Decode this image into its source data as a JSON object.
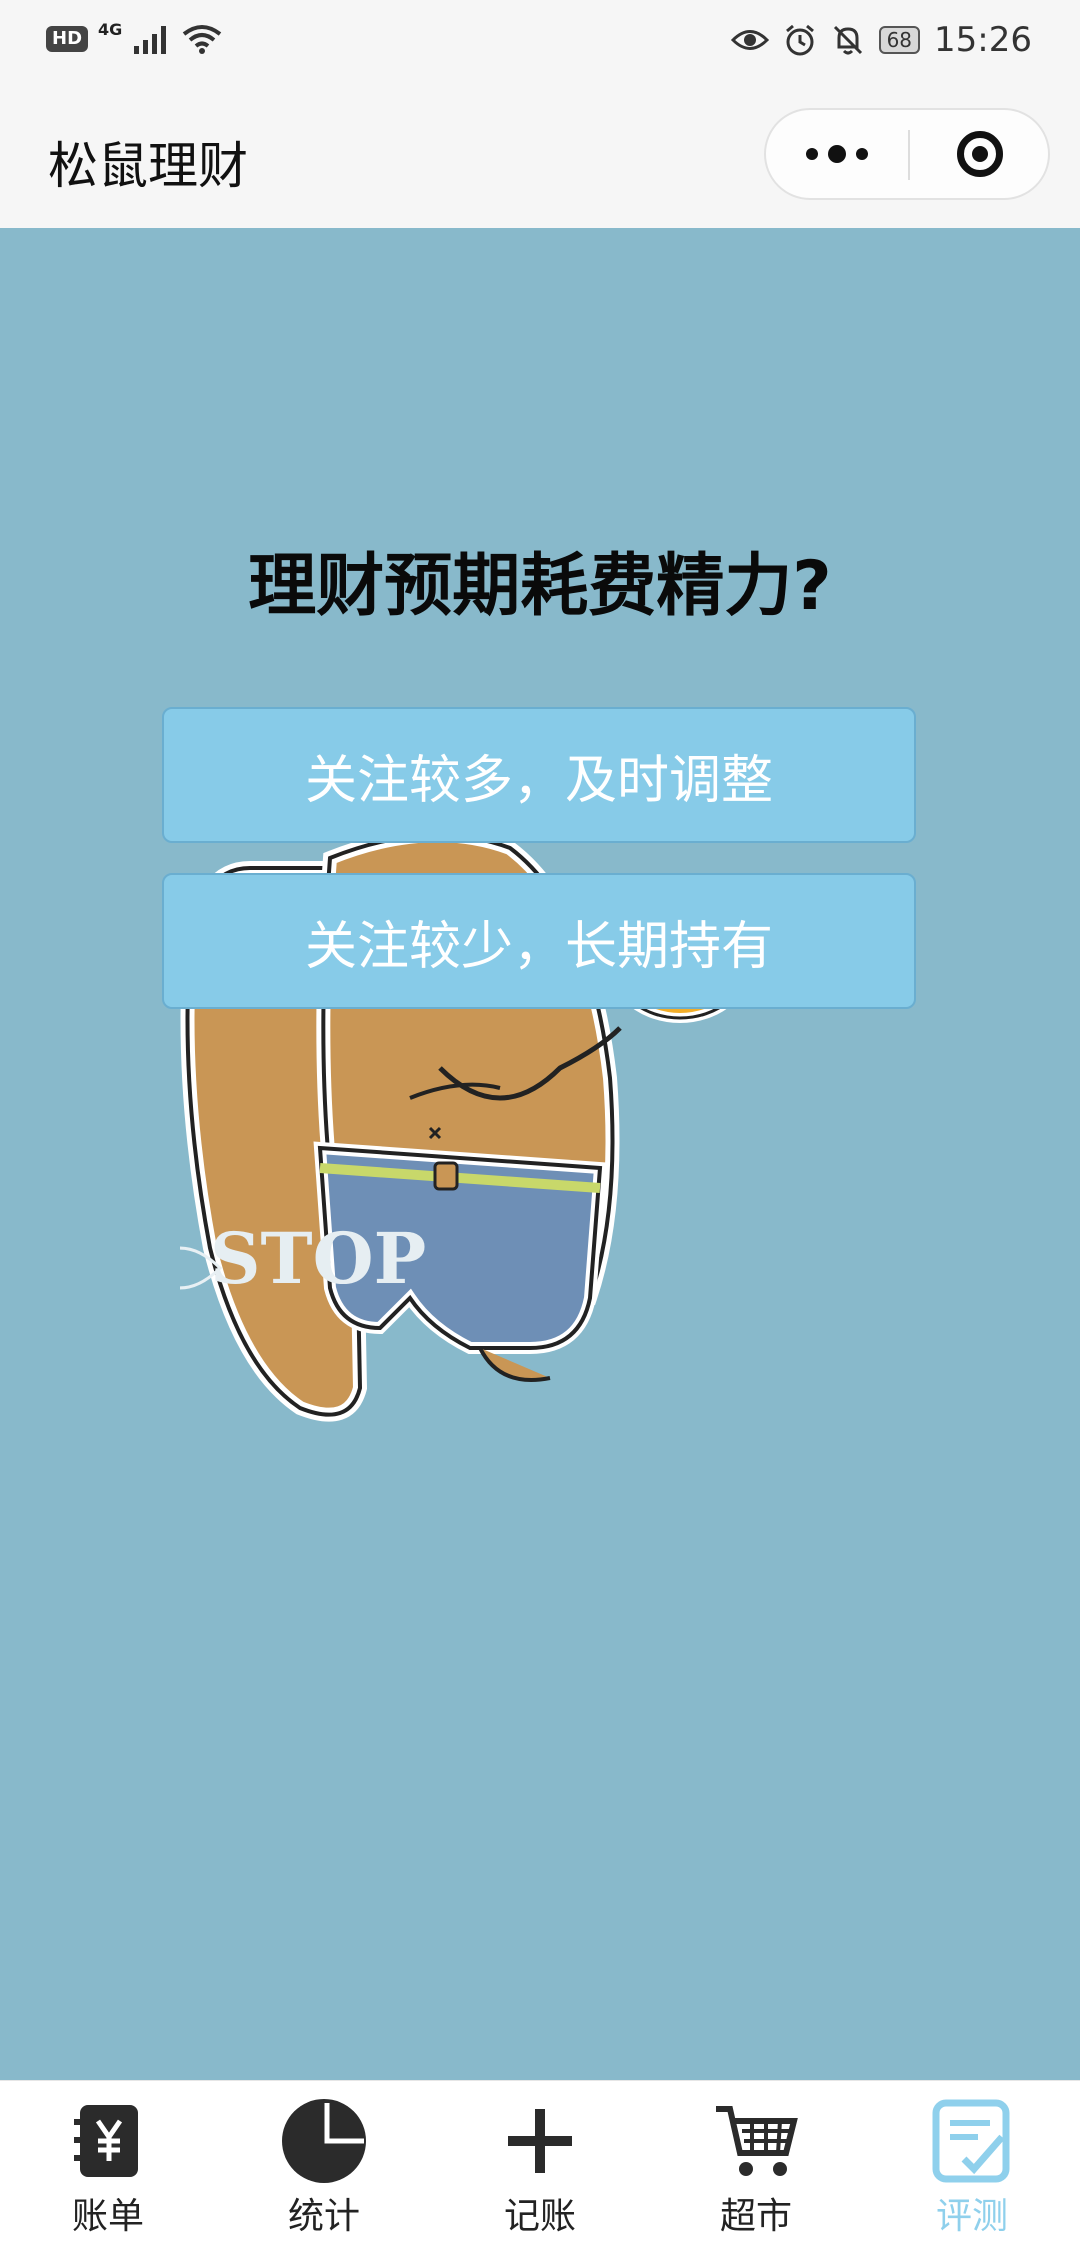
{
  "status_bar": {
    "hd_badge": "HD",
    "network": "4G",
    "battery": "68",
    "time": "15:26"
  },
  "navbar": {
    "title": "松鼠理财"
  },
  "quiz": {
    "question": "理财预期耗费精力?",
    "options": [
      {
        "label": "关注较多，及时调整"
      },
      {
        "label": "关注较少，长期持有"
      }
    ]
  },
  "illustration": {
    "watermark_text": "STOP"
  },
  "tabbar": {
    "items": [
      {
        "label": "账单",
        "icon": "bill-icon"
      },
      {
        "label": "统计",
        "icon": "pie-chart-icon"
      },
      {
        "label": "记账",
        "icon": "plus-icon"
      },
      {
        "label": "超市",
        "icon": "shopping-cart-icon"
      },
      {
        "label": "评测",
        "icon": "assessment-icon",
        "active": true
      }
    ]
  },
  "colors": {
    "background": "#88b9cb",
    "option_bg": "#87cbe8",
    "active_tab": "#8fd0ec"
  }
}
